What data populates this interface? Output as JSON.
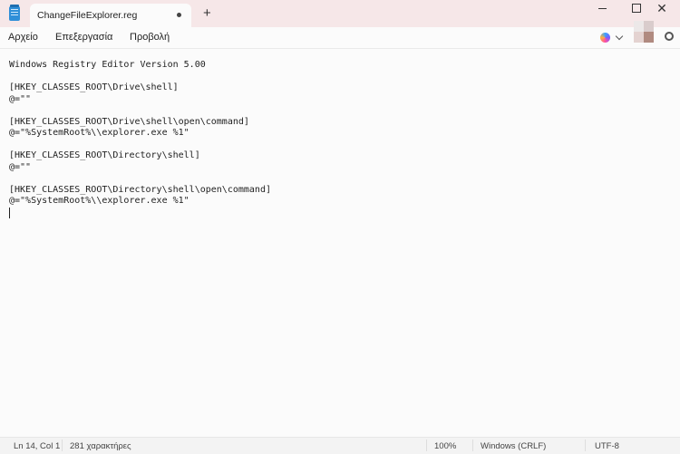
{
  "tab": {
    "title": "ChangeFileExplorer.reg",
    "new_tab_label": "+"
  },
  "window_controls": {
    "close_glyph": "✕"
  },
  "menu": [
    "Αρχείο",
    "Επεξεργασία",
    "Προβολή"
  ],
  "editor": {
    "lines": [
      "Windows Registry Editor Version 5.00",
      "",
      "[HKEY_CLASSES_ROOT\\Drive\\shell]",
      "@=\"\"",
      "",
      "[HKEY_CLASSES_ROOT\\Drive\\shell\\open\\command]",
      "@=\"%SystemRoot%\\\\explorer.exe %1\"",
      "",
      "[HKEY_CLASSES_ROOT\\Directory\\shell]",
      "@=\"\"",
      "",
      "[HKEY_CLASSES_ROOT\\Directory\\shell\\open\\command]",
      "@=\"%SystemRoot%\\\\explorer.exe %1\""
    ]
  },
  "status": {
    "position": "Ln 14, Col 1",
    "char_count": "281 χαρακτήρες",
    "zoom": "100%",
    "line_ending": "Windows (CRLF)",
    "encoding": "UTF-8"
  },
  "icons": {
    "app": "notepad-icon",
    "copilot": "copilot-icon",
    "settings": "gear-icon"
  },
  "colors": {
    "titlebar": "#f6e7e8",
    "editor_bg": "#fbfbfb",
    "avatar": [
      "#ece8e8",
      "#d9cccc",
      "#e4d3d1",
      "#b08a80"
    ]
  }
}
